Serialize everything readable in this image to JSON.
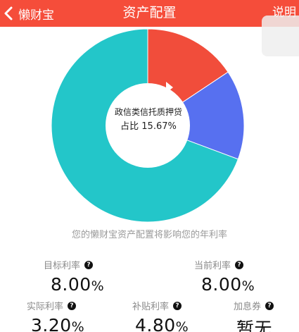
{
  "nav": {
    "back_label": "懒财宝",
    "title": "资产配置",
    "right_label": "说明"
  },
  "colors": {
    "nav": "#f54d3a",
    "segment_red": "#f14d3b",
    "segment_blue": "#5770f0",
    "segment_teal": "#23c6c9"
  },
  "chart_data": {
    "type": "pie",
    "center_label": "政信类信托质押贷",
    "center_value": "占比 15.67%",
    "slices": [
      {
        "value": 15.67,
        "color": "#f14d3b",
        "selected": true
      },
      {
        "value": 15.0,
        "color": "#5770f0"
      },
      {
        "value": 69.33,
        "color": "#23c6c9"
      }
    ]
  },
  "hint": "您的懒财宝资产配置将影响您的年利率",
  "stats": {
    "target": {
      "label": "目标利率",
      "value": "8.00",
      "unit": "%"
    },
    "current": {
      "label": "当前利率",
      "value": "8.00",
      "unit": "%"
    },
    "actual": {
      "label": "实际利率",
      "value": "3.20",
      "unit": "%"
    },
    "subsidy": {
      "label": "补贴利率",
      "value": "4.80",
      "unit": "%"
    },
    "bonus": {
      "label": "加息券",
      "value": "暂无"
    }
  }
}
